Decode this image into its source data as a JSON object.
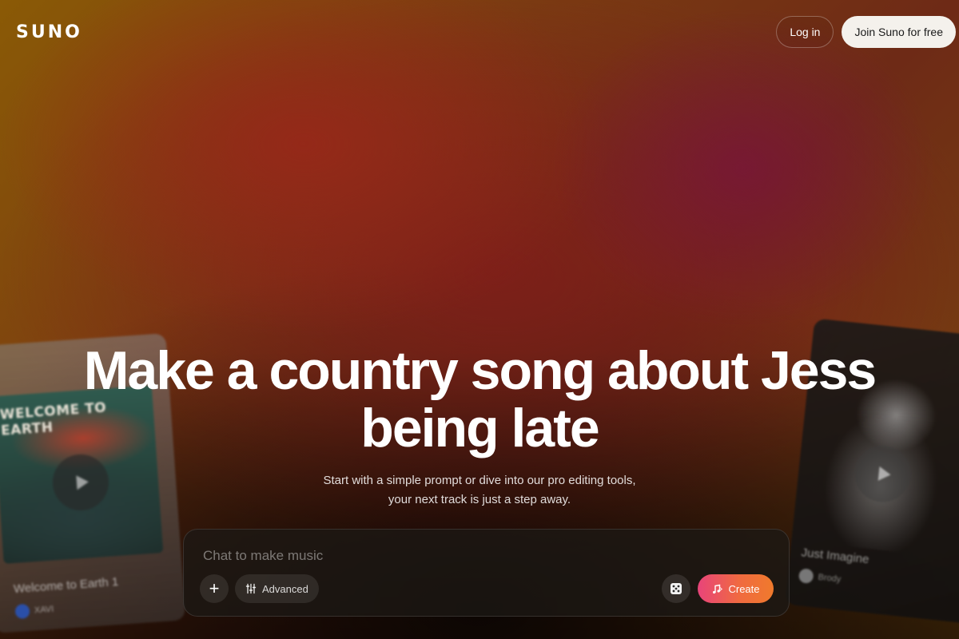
{
  "header": {
    "logo": "SUNO",
    "login_label": "Log in",
    "join_label": "Join Suno for free"
  },
  "hero": {
    "title": "Make a country song about Jess being late",
    "subtitle": "Start with a simple prompt or dive into our pro editing tools, your next track is just a step away."
  },
  "chat": {
    "placeholder": "Chat to make music",
    "add_icon": "plus-icon",
    "advanced_label": "Advanced",
    "advanced_icon": "sliders-icon",
    "random_icon": "dice-icon",
    "create_label": "Create",
    "create_icon": "music-sparkle-icon"
  },
  "cards": [
    {
      "art_text": "WELCOME TO EARTH",
      "title": "Welcome to Earth 1",
      "artist": "XAVI"
    },
    {
      "title": "Just Imagine",
      "artist": "Brody"
    }
  ],
  "colors": {
    "create_gradient_start": "#e8447a",
    "create_gradient_end": "#f07a2c",
    "join_button_bg": "#f4f1ec"
  }
}
